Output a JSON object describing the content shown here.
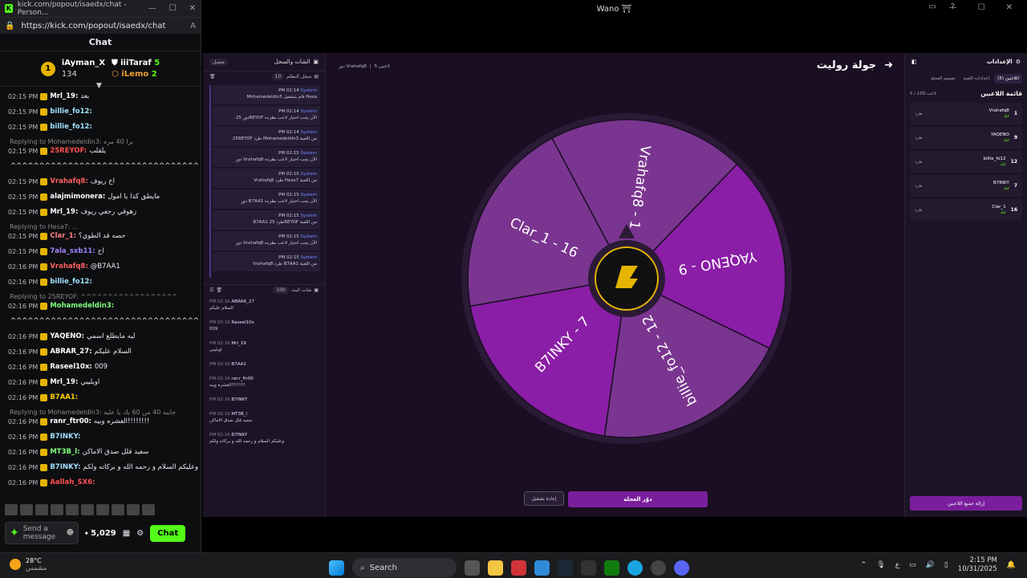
{
  "popout": {
    "title": "kick.com/popout/isaedx/chat - Person...",
    "url": "https://kick.com/popout/isaedx/chat",
    "header": "Chat",
    "leaders": [
      {
        "rank": "1",
        "name": "iAyman_X",
        "points": "134",
        "flag": "5",
        "icon": "crown"
      },
      {
        "name": "iiiTaraf",
        "value": "5"
      },
      {
        "name": "iLemo",
        "value": "2"
      }
    ],
    "messages": [
      {
        "time": "02:15 PM",
        "user": "Mrl_19:",
        "text": "بعد",
        "color": "#ffffff"
      },
      {
        "time": "02:15 PM",
        "user": "billie_fo12:",
        "text": "",
        "color": "#a0e0ff"
      },
      {
        "time": "02:15 PM",
        "user": "billie_fo12:",
        "text": "",
        "color": "#a0e0ff"
      },
      {
        "reply": "Replying to Mohamedeldin3: برا 40 مره"
      },
      {
        "time": "02:15 PM",
        "user": "25REYOF:",
        "text": "يلقلب",
        "color": "#ff5050"
      },
      {
        "time": "",
        "user": "",
        "text": "^^^^^^^^^^^^^^^^^^^^^^^^^^^^^^^^^^^^",
        "color": "#ffffff"
      },
      {
        "time": "02:15 PM",
        "user": "Vrahafq8:",
        "text": "اخ ريوف",
        "color": "#ff6060"
      },
      {
        "time": "02:15 PM",
        "user": "alajmimonera:",
        "text": "مايطق كذا يا امول",
        "color": "#ffffff"
      },
      {
        "time": "02:15 PM",
        "user": "Mrl_19:",
        "text": "زهوقي رجعي ريوف",
        "color": "#ffffff"
      },
      {
        "reply": "Replying to Hesa7: ..."
      },
      {
        "time": "02:15 PM",
        "user": "Clar_1:",
        "text": "حصه قد الطوي؟",
        "color": "#ff8080"
      },
      {
        "time": "02:15 PM",
        "user": "7ala_sxb11:",
        "text": "اح",
        "color": "#a080ff"
      },
      {
        "time": "02:16 PM",
        "user": "Vrahafq8:",
        "text": "@B7AA1",
        "color": "#ff6060"
      },
      {
        "time": "02:16 PM",
        "user": "billie_fo12:",
        "text": "",
        "color": "#a0e0ff"
      },
      {
        "reply": "Replying to 25REYOF: ^^^^^^^^^^^^^^^^^^"
      },
      {
        "time": "02:16 PM",
        "user": "Mohamedeldin3:",
        "text": "",
        "color": "#80ff80"
      },
      {
        "time": "",
        "user": "",
        "text": "^^^^^^^^^^^^^^^^^^^^^^^^^^^^^^^^^^^",
        "color": "#ffffff"
      },
      {
        "time": "02:16 PM",
        "user": "YAQENO:",
        "text": "ليه مايطلع اسمي",
        "color": "#ffffff"
      },
      {
        "time": "02:16 PM",
        "user": "ABRAR_27:",
        "text": "السلام عليكم",
        "color": "#ffffff"
      },
      {
        "time": "02:16 PM",
        "user": "Raseel10x:",
        "text": "009",
        "color": "#ffffff"
      },
      {
        "time": "02:16 PM",
        "user": "Mrl_19:",
        "text": "اوبليبي",
        "color": "#ffffff"
      },
      {
        "time": "02:16 PM",
        "user": "B7AA1:",
        "text": "",
        "color": "#ffd000"
      },
      {
        "reply": "Replying to Mohamedeldin3: جايبه 40 من 60 بك يا عليه"
      },
      {
        "time": "02:16 PM",
        "user": "ranr_ftr00:",
        "text": "العشره وبيه!!!!!!!!",
        "color": "#ffffff"
      },
      {
        "time": "02:16 PM",
        "user": "B7INKY:",
        "text": "",
        "color": "#a0e0ff"
      },
      {
        "time": "02:16 PM",
        "user": "MT3B_l:",
        "text": "سعيد قلل صدق الاماكن",
        "color": "#80ff80"
      },
      {
        "time": "02:16 PM",
        "user": "B7INKY:",
        "text": "وعليكم السلام و رحمه الله و بركاته ولكم",
        "color": "#a0e0ff"
      },
      {
        "time": "02:16 PM",
        "user": "Aallah_SX6:",
        "text": "",
        "color": "#ff5050"
      }
    ],
    "send_placeholder": "Send a message",
    "points": "5,029",
    "chat_button": "Chat"
  },
  "window": {
    "title": "Wano ⛩"
  },
  "log_panel": {
    "title": "الشات والسجل",
    "toggle_label": "متصل",
    "system_section": "سجل النظام",
    "system_count": "10",
    "system_items": [
      {
        "sender": "System",
        "time": "PM 02:14",
        "text": "Mohamedeldin3 قام بتشغيل Hesa"
      },
      {
        "sender": "System",
        "time": "PM 02:14",
        "text": "دور 25REYOF الآن يجب اختيار لاعب بطرده"
      },
      {
        "sender": "System",
        "time": "PM 02:14",
        "text": "25REYOF طرد Mohamedeldin3 من اللعبة"
      },
      {
        "sender": "System",
        "time": "PM 02:15",
        "text": "دور Vrahafq8 الآن يجب اختيار لاعب بطرده"
      },
      {
        "sender": "System",
        "time": "PM 02:15",
        "text": "Vrahafq8 طرد Hesa7 من اللعبة"
      },
      {
        "sender": "System",
        "time": "PM 02:15",
        "text": "دور B7AA1 الآن يجب اختيار لاعب بطرده"
      },
      {
        "sender": "System",
        "time": "PM 02:15",
        "text": "B7AA1 طرد 25REYOF من اللعبة"
      },
      {
        "sender": "System",
        "time": "PM 02:15",
        "text": "دور Vrahafq8 الآن يجب اختيار لاعب بطرده"
      },
      {
        "sender": "System",
        "time": "PM 02:15",
        "text": "Vrahafq8 طرد B7AA1 من اللعبة"
      }
    ],
    "live_section": "شات البث",
    "live_count": "100",
    "live_items": [
      {
        "user": "ABRAR_27",
        "time": "PM 02:16",
        "text": "السلام عليكم"
      },
      {
        "user": "Raseel10x",
        "time": "PM 02:16",
        "text": "009"
      },
      {
        "user": "Mrl_19",
        "time": "PM 02:16",
        "text": "اوبليبي"
      },
      {
        "user": "B7AA1",
        "time": "PM 02:16",
        "text": ""
      },
      {
        "user": "ranr_ftr00",
        "time": "PM 02:16",
        "text": "العشره وبيه!!!!!!!!"
      },
      {
        "user": "B7INKY",
        "time": "PM 02:16",
        "text": ""
      },
      {
        "user": "MT3B_l",
        "time": "PM 02:16",
        "text": "سعيد قلل صدق الاماكن"
      },
      {
        "user": "B7INKY",
        "time": "PM 02:16",
        "text": "وعليكم السلام و رحمه الله و بركاته ولكم"
      }
    ]
  },
  "game": {
    "title": "جولة روليت",
    "turn_players": "5 لاعبين",
    "turn_label": "دور Vrahafq8",
    "segments": [
      {
        "label": "Vrahafq8 - 1",
        "color": "#7a3590"
      },
      {
        "label": "YAQENO - 9",
        "color": "#8a1ea6"
      },
      {
        "label": "billie_fo12 - 12",
        "color": "#7a3590"
      },
      {
        "label": "B7INKY - 7",
        "color": "#8a1ea6"
      },
      {
        "label": "Clar_1 - 16",
        "color": "#7a3590"
      }
    ],
    "spin_button": "دوّر العجلة",
    "restart_button": "إعادة تشغيل"
  },
  "settings": {
    "title": "الإعدادات",
    "tabs": [
      "اللاعبين (5)",
      "إعدادات اللعبة",
      "تصميم العجلة"
    ],
    "players_title": "قائمة اللاعبين",
    "players_count": "5 / 100 لاعب",
    "players": [
      {
        "name": "Vrahafq8",
        "num": "1",
        "status": "كيك"
      },
      {
        "name": "YAQENO",
        "num": "9",
        "status": "كيك"
      },
      {
        "name": "billie_fo12",
        "num": "12",
        "status": "كيك"
      },
      {
        "name": "B7INKY",
        "num": "7",
        "status": "كيك"
      },
      {
        "name": "Clar_1",
        "num": "16",
        "status": "كيك"
      }
    ],
    "remove_label": "طرد",
    "clear_button": "إزالة جميع اللاعبين"
  },
  "taskbar": {
    "temp": "28°C",
    "weather": "مشمس",
    "search": "Search",
    "lang": "ع",
    "time": "2:15 PM",
    "date": "10/31/2025"
  }
}
